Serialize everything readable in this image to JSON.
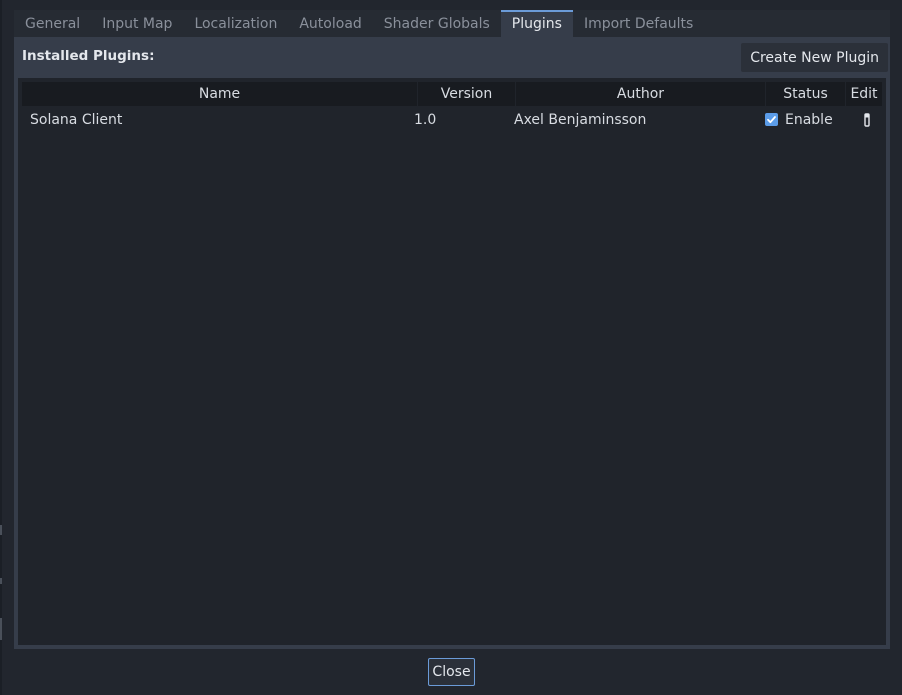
{
  "tabs": [
    {
      "label": "General",
      "active": false
    },
    {
      "label": "Input Map",
      "active": false
    },
    {
      "label": "Localization",
      "active": false
    },
    {
      "label": "Autoload",
      "active": false
    },
    {
      "label": "Shader Globals",
      "active": false
    },
    {
      "label": "Plugins",
      "active": true
    },
    {
      "label": "Import Defaults",
      "active": false
    }
  ],
  "plugins": {
    "installed_label": "Installed Plugins:",
    "create_button": "Create New Plugin",
    "columns": {
      "name": "Name",
      "version": "Version",
      "author": "Author",
      "status": "Status",
      "edit": "Edit"
    },
    "rows": [
      {
        "name": "Solana Client",
        "version": "1.0",
        "author": "Axel Benjaminsson",
        "status_label": "Enable",
        "enabled": true,
        "edit_icon": "edit-icon"
      }
    ]
  },
  "footer": {
    "close_label": "Close"
  },
  "colors": {
    "accent": "#6b9bd8",
    "checkbox": "#5b9ce8",
    "panel": "#363d4a",
    "background": "#22262e"
  }
}
